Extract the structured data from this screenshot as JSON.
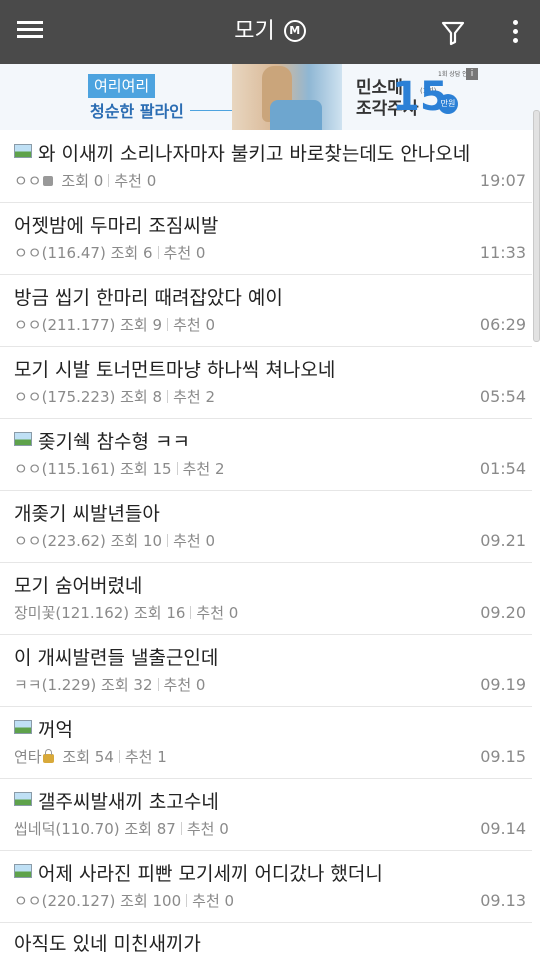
{
  "header": {
    "title": "모기",
    "title_badge": "M",
    "icons": [
      "menu-icon",
      "filter-icon",
      "more-vertical-icon"
    ],
    "bar_color": "#4a4a4a"
  },
  "ad": {
    "left_badge": "여리여리",
    "left_text": "청순한 팔라인",
    "mid_line1": "민소매",
    "mid_line2": "조각주사",
    "number": "15",
    "unit_circle": "만원",
    "unit_small": "(1회)",
    "tiny": "1회 상담 안내",
    "close_label": "i"
  },
  "posts": [
    {
      "has_image": true,
      "title": "와 이새끼 소리나자마자 불키고 바로찾는데도 안나오네",
      "author": "ㅇㅇ",
      "author_badge": "square",
      "views_label": "조회",
      "views": "0",
      "likes_label": "추천",
      "likes": "0",
      "time": "19:07"
    },
    {
      "has_image": false,
      "title": "어젯밤에 두마리 조짐씨발",
      "author": "ㅇㅇ(116.47)",
      "author_badge": "",
      "views_label": "조회",
      "views": "6",
      "likes_label": "추천",
      "likes": "0",
      "time": "11:33"
    },
    {
      "has_image": false,
      "title": "방금 씹기 한마리 때려잡았다 예이",
      "author": "ㅇㅇ(211.177)",
      "author_badge": "",
      "views_label": "조회",
      "views": "9",
      "likes_label": "추천",
      "likes": "0",
      "time": "06:29"
    },
    {
      "has_image": false,
      "title": "모기 시발 토너먼트마냥 하나씩 쳐나오네",
      "author": "ㅇㅇ(175.223)",
      "author_badge": "",
      "views_label": "조회",
      "views": "8",
      "likes_label": "추천",
      "likes": "2",
      "time": "05:54"
    },
    {
      "has_image": true,
      "title": "좆기쉑 참수형 ㅋㅋ",
      "author": "ㅇㅇ(115.161)",
      "author_badge": "",
      "views_label": "조회",
      "views": "15",
      "likes_label": "추천",
      "likes": "2",
      "time": "01:54"
    },
    {
      "has_image": false,
      "title": "개좆기 씨발년들아",
      "author": "ㅇㅇ(223.62)",
      "author_badge": "",
      "views_label": "조회",
      "views": "10",
      "likes_label": "추천",
      "likes": "0",
      "time": "09.21"
    },
    {
      "has_image": false,
      "title": "모기 숨어버렸네",
      "author": "장미꽃(121.162)",
      "author_badge": "",
      "views_label": "조회",
      "views": "16",
      "likes_label": "추천",
      "likes": "0",
      "time": "09.20"
    },
    {
      "has_image": false,
      "title": "이 개씨발련들 낼출근인데",
      "author": "ㅋㅋ(1.229)",
      "author_badge": "",
      "views_label": "조회",
      "views": "32",
      "likes_label": "추천",
      "likes": "0",
      "time": "09.19"
    },
    {
      "has_image": true,
      "title": "꺼억",
      "author": "연타",
      "author_badge": "lock",
      "views_label": "조회",
      "views": "54",
      "likes_label": "추천",
      "likes": "1",
      "time": "09.15"
    },
    {
      "has_image": true,
      "title": "갤주씨발새끼 초고수네",
      "author": "씹네덕(110.70)",
      "author_badge": "",
      "views_label": "조회",
      "views": "87",
      "likes_label": "추천",
      "likes": "0",
      "time": "09.14"
    },
    {
      "has_image": true,
      "title": "어제 사라진 피빤 모기세끼 어디갔나 했더니",
      "author": "ㅇㅇ(220.127)",
      "author_badge": "",
      "views_label": "조회",
      "views": "100",
      "likes_label": "추천",
      "likes": "0",
      "time": "09.13"
    }
  ],
  "partial_post": {
    "title": "아직도 있네 미친새끼가"
  }
}
